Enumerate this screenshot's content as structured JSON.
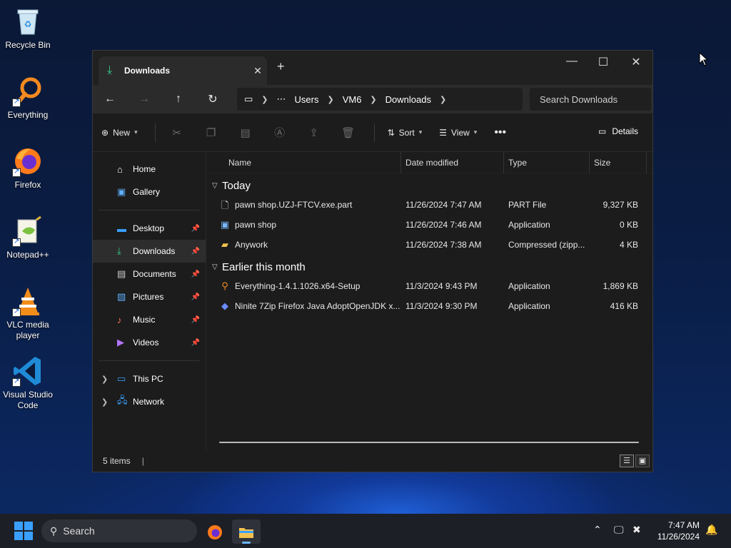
{
  "desktop": {
    "icons": [
      {
        "label": "Recycle Bin"
      },
      {
        "label": "Everything"
      },
      {
        "label": "Firefox"
      },
      {
        "label": "Notepad++"
      },
      {
        "label": "VLC media player"
      },
      {
        "label": "Visual Studio Code"
      }
    ]
  },
  "window": {
    "tab_title": "Downloads",
    "breadcrumbs": [
      "Users",
      "VM6",
      "Downloads"
    ],
    "search_placeholder": "Search Downloads",
    "toolbar": {
      "new_label": "New",
      "sort_label": "Sort",
      "view_label": "View",
      "details_label": "Details"
    },
    "sidebar": {
      "quick": [
        {
          "label": "Home",
          "icon": "home-icon"
        },
        {
          "label": "Gallery",
          "icon": "gallery-icon"
        }
      ],
      "pinned": [
        {
          "label": "Desktop",
          "icon": "desktop-icon"
        },
        {
          "label": "Downloads",
          "icon": "downloads-icon"
        },
        {
          "label": "Documents",
          "icon": "documents-icon"
        },
        {
          "label": "Pictures",
          "icon": "pictures-icon"
        },
        {
          "label": "Music",
          "icon": "music-icon"
        },
        {
          "label": "Videos",
          "icon": "videos-icon"
        }
      ],
      "locations": [
        {
          "label": "This PC",
          "icon": "pc-icon"
        },
        {
          "label": "Network",
          "icon": "network-icon"
        }
      ]
    },
    "columns": [
      "Name",
      "Date modified",
      "Type",
      "Size"
    ],
    "groups": [
      {
        "label": "Today",
        "files": [
          {
            "name": "pawn shop.UZJ-FTCV.exe.part",
            "date": "11/26/2024 7:47 AM",
            "type": "PART File",
            "size": "9,327 KB",
            "icon": "file-icon"
          },
          {
            "name": "pawn shop",
            "date": "11/26/2024 7:46 AM",
            "type": "Application",
            "size": "0 KB",
            "icon": "app-icon"
          },
          {
            "name": "Anywork",
            "date": "11/26/2024 7:38 AM",
            "type": "Compressed (zipp...",
            "size": "4 KB",
            "icon": "zip-folder-icon"
          }
        ]
      },
      {
        "label": "Earlier this month",
        "files": [
          {
            "name": "Everything-1.4.1.1026.x64-Setup",
            "date": "11/3/2024 9:43 PM",
            "type": "Application",
            "size": "1,869 KB",
            "icon": "everything-icon"
          },
          {
            "name": "Ninite 7Zip Firefox Java AdoptOpenJDK x...",
            "date": "11/3/2024 9:30 PM",
            "type": "Application",
            "size": "416 KB",
            "icon": "ninite-icon"
          }
        ]
      }
    ],
    "status_text": "5 items"
  },
  "taskbar": {
    "search_label": "Search",
    "time": "7:47 AM",
    "date": "11/26/2024"
  },
  "colors": {
    "accent": "#3ad18f",
    "taskbar_indicator": "#6fb6ff"
  }
}
